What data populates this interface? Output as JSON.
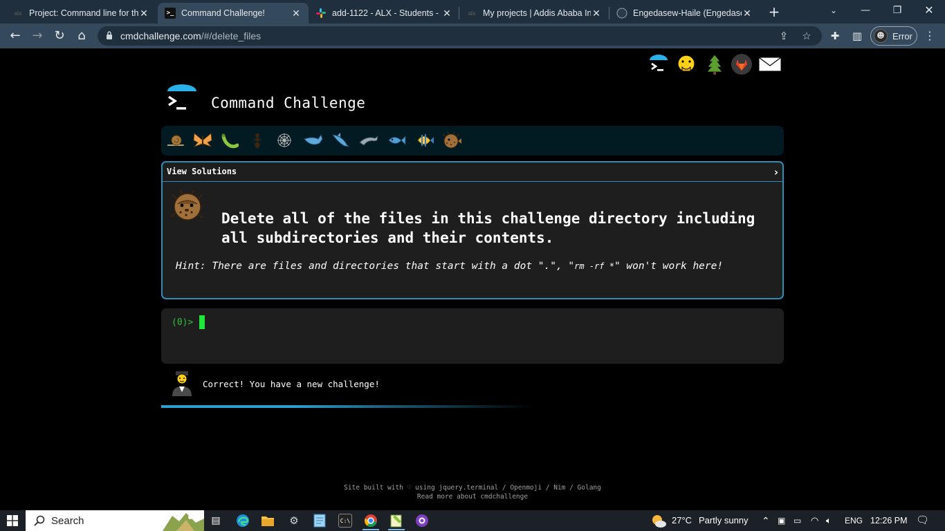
{
  "browser": {
    "tabs": [
      {
        "title": "Project: Command line for th",
        "favicon": "alx-logo"
      },
      {
        "title": "Command Challenge!",
        "favicon": "terminal-favicon"
      },
      {
        "title": "add-1122 - ALX - Students -",
        "favicon": "slack-logo"
      },
      {
        "title": "My projects | Addis Ababa In",
        "favicon": "alx-logo"
      },
      {
        "title": "Engedasew-Haile (Engedasew",
        "favicon": "github-logo"
      }
    ],
    "url_host": "cmdchallenge.com",
    "url_path": "/#/delete_files",
    "profile_label": "Error"
  },
  "page": {
    "top_icons": [
      "terminal-icon",
      "face-hand-over-mouth-icon",
      "evergreen-tree-icon",
      "gitlab-icon",
      "envelope-icon"
    ],
    "site_title": "Command Challenge",
    "level_icons": [
      "snail-icon",
      "butterfly-icon",
      "bug-icon",
      "ant-icon",
      "spider-web-icon",
      "whale-icon",
      "shark-icon",
      "dolphin-icon",
      "fish-icon",
      "tropical-fish-icon",
      "blowfish-icon"
    ],
    "view_solutions_label": "View Solutions",
    "challenge_text": "Delete all of the files in this challenge directory including all subdirectories and their contents.",
    "hint_prefix": "Hint: There are files and directories that start with a dot \".\", \"",
    "hint_code": "rm -rf *",
    "hint_suffix": "\" won't work here!",
    "prompt": "(0)>",
    "status_message": "Correct! You have a new challenge!",
    "progress_fraction": 0.6,
    "footer_line1": "Site built with ♡ using jquery.terminal / Openmoji / Nim / Golang",
    "footer_line2": "Read more about cmdchallenge"
  },
  "taskbar": {
    "search_label": "Search",
    "weather_temp": "27°C",
    "weather_desc": "Partly sunny",
    "language": "ENG",
    "time": "12:26 PM"
  },
  "colors": {
    "accent": "#2b8fb8",
    "prompt_green": "#2ec23a",
    "level_bar_bg": "#021a22"
  }
}
